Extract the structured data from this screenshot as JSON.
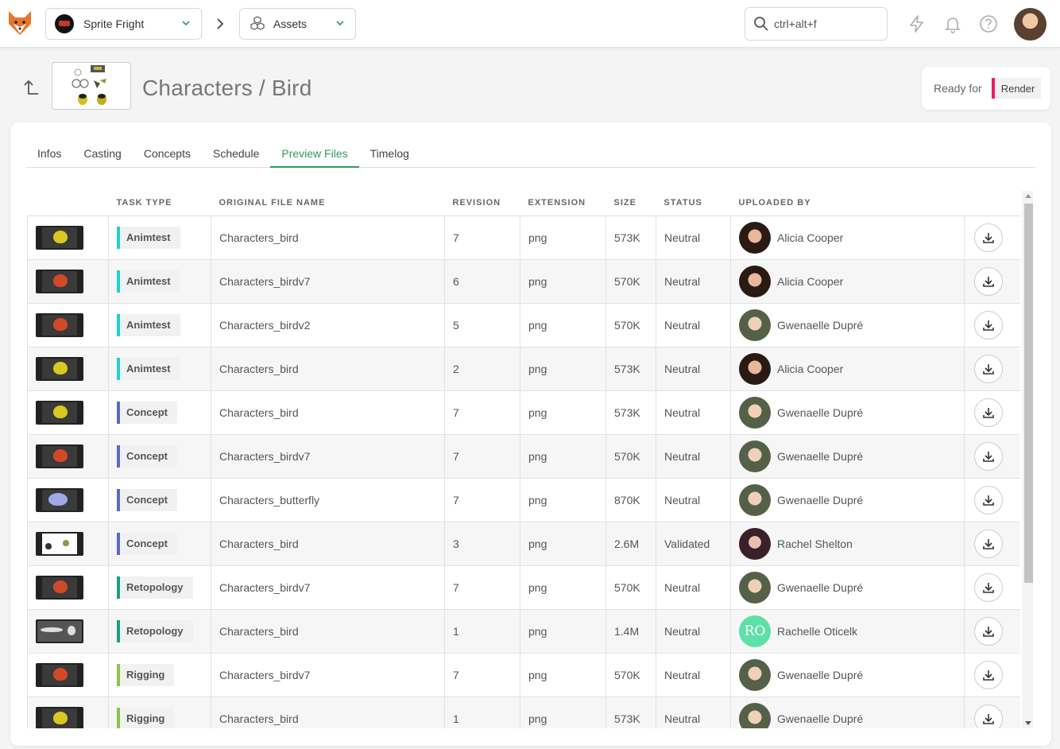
{
  "topbar": {
    "production": "Sprite Fright",
    "section": "Assets",
    "search_placeholder": "ctrl+alt+f",
    "icons": [
      "fox-logo-icon",
      "lightning-icon",
      "bell-icon",
      "help-icon"
    ]
  },
  "header": {
    "title": "Characters / Bird",
    "ready_for_label": "Ready for",
    "ready_for_value": "Render",
    "ready_color": "#e91e63"
  },
  "tabs": [
    {
      "label": "Infos",
      "active": false
    },
    {
      "label": "Casting",
      "active": false
    },
    {
      "label": "Concepts",
      "active": false
    },
    {
      "label": "Schedule",
      "active": false
    },
    {
      "label": "Preview Files",
      "active": true
    },
    {
      "label": "Timelog",
      "active": false
    }
  ],
  "table": {
    "columns": {
      "task_type": "TASK TYPE",
      "original_file_name": "ORIGINAL FILE NAME",
      "revision": "REVISION",
      "extension": "EXTENSION",
      "size": "SIZE",
      "status": "STATUS",
      "uploaded_by": "UPLOADED BY"
    },
    "task_colors": {
      "Animtest": "#22d0d0",
      "Concept": "#5c6bc0",
      "Retopology": "#16a085",
      "Rigging": "#8bc34a"
    },
    "rows": [
      {
        "thumb": "yellow-bird",
        "task_type": "Animtest",
        "file": "Characters_bird",
        "revision": "7",
        "extension": "png",
        "size": "573K",
        "status": "Neutral",
        "uploader": "Alicia Cooper",
        "avatar": "alicia"
      },
      {
        "thumb": "red-bird",
        "task_type": "Animtest",
        "file": "Characters_birdv7",
        "revision": "6",
        "extension": "png",
        "size": "570K",
        "status": "Neutral",
        "uploader": "Alicia Cooper",
        "avatar": "alicia"
      },
      {
        "thumb": "red-bird",
        "task_type": "Animtest",
        "file": "Characters_birdv2",
        "revision": "5",
        "extension": "png",
        "size": "570K",
        "status": "Neutral",
        "uploader": "Gwenaelle Dupré",
        "avatar": "gwen"
      },
      {
        "thumb": "yellow-bird",
        "task_type": "Animtest",
        "file": "Characters_bird",
        "revision": "2",
        "extension": "png",
        "size": "573K",
        "status": "Neutral",
        "uploader": "Alicia Cooper",
        "avatar": "alicia"
      },
      {
        "thumb": "yellow-bird",
        "task_type": "Concept",
        "file": "Characters_bird",
        "revision": "7",
        "extension": "png",
        "size": "573K",
        "status": "Neutral",
        "uploader": "Gwenaelle Dupré",
        "avatar": "gwen"
      },
      {
        "thumb": "red-bird",
        "task_type": "Concept",
        "file": "Characters_birdv7",
        "revision": "7",
        "extension": "png",
        "size": "570K",
        "status": "Neutral",
        "uploader": "Gwenaelle Dupré",
        "avatar": "gwen"
      },
      {
        "thumb": "butterfly",
        "task_type": "Concept",
        "file": "Characters_butterfly",
        "revision": "7",
        "extension": "png",
        "size": "870K",
        "status": "Neutral",
        "uploader": "Gwenaelle Dupré",
        "avatar": "gwen"
      },
      {
        "thumb": "sheet",
        "task_type": "Concept",
        "file": "Characters_bird",
        "revision": "3",
        "extension": "png",
        "size": "2.6M",
        "status": "Validated",
        "uploader": "Rachel Shelton",
        "avatar": "rachel"
      },
      {
        "thumb": "red-bird",
        "task_type": "Retopology",
        "file": "Characters_birdv7",
        "revision": "7",
        "extension": "png",
        "size": "570K",
        "status": "Neutral",
        "uploader": "Gwenaelle Dupré",
        "avatar": "gwen"
      },
      {
        "thumb": "turnaround",
        "task_type": "Retopology",
        "file": "Characters_bird",
        "revision": "1",
        "extension": "png",
        "size": "1.4M",
        "status": "Neutral",
        "uploader": "Rachelle Oticelk",
        "avatar": "initials",
        "initials": "RO"
      },
      {
        "thumb": "red-bird",
        "task_type": "Rigging",
        "file": "Characters_birdv7",
        "revision": "7",
        "extension": "png",
        "size": "570K",
        "status": "Neutral",
        "uploader": "Gwenaelle Dupré",
        "avatar": "gwen"
      },
      {
        "thumb": "yellow-bird",
        "task_type": "Rigging",
        "file": "Characters_bird",
        "revision": "1",
        "extension": "png",
        "size": "573K",
        "status": "Neutral",
        "uploader": "Gwenaelle Dupré",
        "avatar": "gwen"
      }
    ]
  }
}
